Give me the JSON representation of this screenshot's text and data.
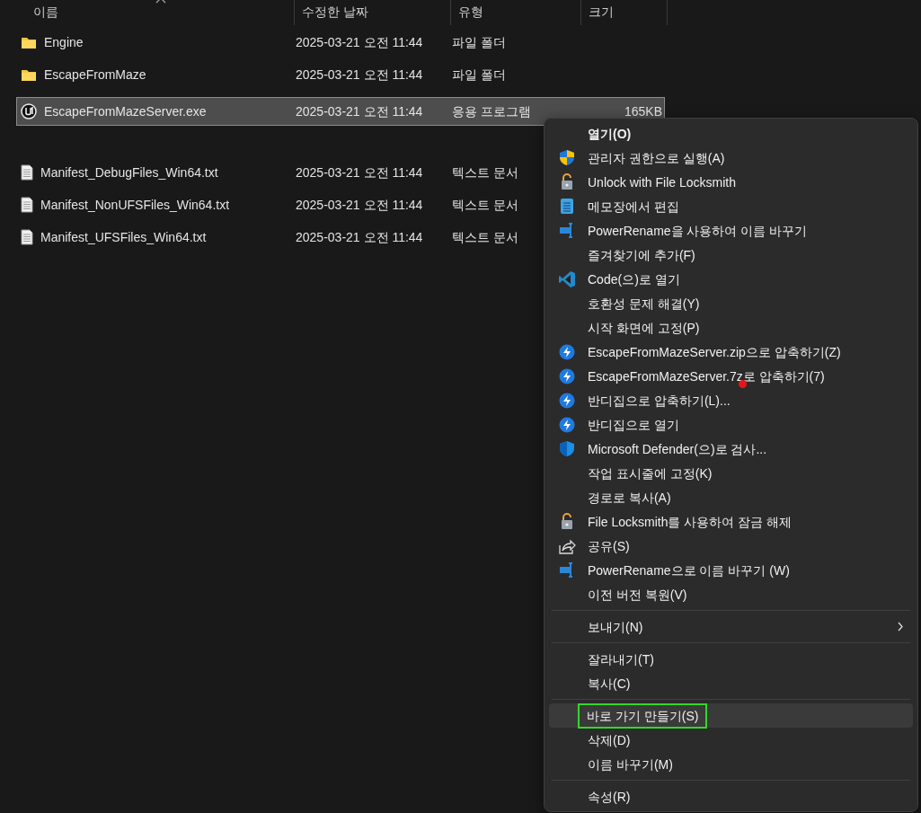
{
  "columns": [
    {
      "label": "이름"
    },
    {
      "label": "수정한 날짜"
    },
    {
      "label": "유형"
    },
    {
      "label": "크기"
    }
  ],
  "rows": [
    {
      "kind": "folder",
      "name": "Engine",
      "date": "2025-03-21 오전 11:44",
      "type": "파일 폴더",
      "selected": false
    },
    {
      "kind": "folder",
      "name": "EscapeFromMaze",
      "date": "2025-03-21 오전 11:44",
      "type": "파일 폴더",
      "selected": false
    },
    {
      "kind": "app",
      "name": "EscapeFromMazeServer.exe",
      "date": "2025-03-21 오전 11:44",
      "type": "응용 프로그램",
      "size": "165KB",
      "selected": true
    },
    {
      "kind": "blank"
    },
    {
      "kind": "text",
      "name": "Manifest_DebugFiles_Win64.txt",
      "date": "2025-03-21 오전 11:44",
      "type": "텍스트 문서",
      "selected": false
    },
    {
      "kind": "text",
      "name": "Manifest_NonUFSFiles_Win64.txt",
      "date": "2025-03-21 오전 11:44",
      "type": "텍스트 문서",
      "selected": false
    },
    {
      "kind": "text",
      "name": "Manifest_UFSFiles_Win64.txt",
      "date": "2025-03-21 오전 11:44",
      "type": "텍스트 문서",
      "selected": false
    }
  ],
  "context_menu": {
    "sections": [
      [
        {
          "label": "열기(O)",
          "default": true,
          "hovered": false
        },
        {
          "label": "관리자 권한으로 실행(A)",
          "kind": "shield",
          "hovered": false
        },
        {
          "label": "Unlock with File Locksmith",
          "kind": "lock",
          "hovered": false
        },
        {
          "label": "메모장에서 편집",
          "kind": "notepad",
          "hovered": false
        },
        {
          "label": "PowerRename을 사용하여 이름 바꾸기",
          "kind": "rename",
          "hovered": false
        },
        {
          "label": "즐겨찾기에 추가(F)",
          "hovered": false
        },
        {
          "label": "Code(으)로 열기",
          "kind": "code",
          "hovered": false
        },
        {
          "label": "호환성 문제 해결(Y)",
          "hovered": false
        },
        {
          "label": "시작 화면에 고정(P)",
          "hovered": false
        },
        {
          "label": "EscapeFromMazeServer.zip으로 압축하기(Z)",
          "kind": "bolt",
          "hovered": false
        },
        {
          "label": "EscapeFromMazeServer.7z로 압축하기(7)",
          "kind": "bolt",
          "hovered": false
        },
        {
          "label": "반디집으로 압축하기(L)...",
          "kind": "bolt",
          "hovered": false
        },
        {
          "label": "반디집으로 열기",
          "kind": "bolt",
          "hovered": false
        },
        {
          "label": "Microsoft Defender(으)로 검사...",
          "kind": "defender",
          "hovered": false
        },
        {
          "label": "작업 표시줄에 고정(K)",
          "hovered": false
        },
        {
          "label": "경로로 복사(A)",
          "hovered": false
        },
        {
          "label": "File Locksmith를 사용하여 잠금 해제",
          "kind": "lock",
          "hovered": false
        },
        {
          "label": "공유(S)",
          "kind": "share",
          "hovered": false
        },
        {
          "label": "PowerRename으로 이름 바꾸기 (W)",
          "kind": "rename",
          "hovered": false
        },
        {
          "label": "이전 버전 복원(V)",
          "hovered": false
        }
      ],
      [
        {
          "label": "보내기(N)",
          "submenu": true,
          "hovered": false
        }
      ],
      [
        {
          "label": "잘라내기(T)",
          "hovered": false
        },
        {
          "label": "복사(C)",
          "hovered": false
        }
      ],
      [
        {
          "label": "바로 가기 만들기(S)",
          "hovered": true,
          "outlined": true
        },
        {
          "label": "삭제(D)",
          "hovered": false
        },
        {
          "label": "이름 바꾸기(M)",
          "hovered": false
        }
      ],
      [
        {
          "label": "속성(R)",
          "hovered": false
        }
      ]
    ]
  },
  "marker": {
    "color": "#e8141c"
  }
}
